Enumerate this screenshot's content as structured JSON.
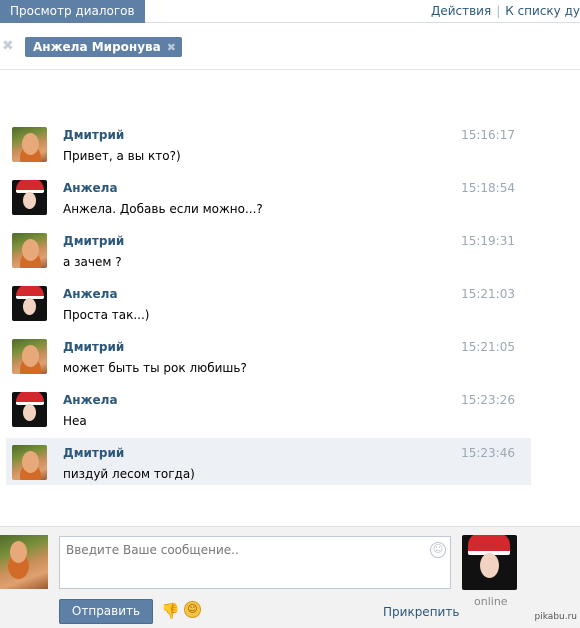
{
  "topbar": {
    "tab": "Просмотр диалогов",
    "links": [
      "Действия",
      "К списку ду"
    ]
  },
  "recipient": {
    "name": "Анжела Миронува"
  },
  "messages": [
    {
      "author": "Дмитрий",
      "text": "Привет, а вы кто?)",
      "time": "15:16:17",
      "avatar": "dmitry"
    },
    {
      "author": "Анжела",
      "text": "Анжела. Добавь если можно...?",
      "time": "15:18:54",
      "avatar": "anzhela"
    },
    {
      "author": "Дмитрий",
      "text": "а зачем ?",
      "time": "15:19:31",
      "avatar": "dmitry"
    },
    {
      "author": "Анжела",
      "text": "Проста так...)",
      "time": "15:21:03",
      "avatar": "anzhela"
    },
    {
      "author": "Дмитрий",
      "text": "может быть ты рок любишь?",
      "time": "15:21:05",
      "avatar": "dmitry"
    },
    {
      "author": "Анжела",
      "text": "Неа",
      "time": "15:23:26",
      "avatar": "anzhela"
    },
    {
      "author": "Дмитрий",
      "text": "пиздуй лесом тогда)",
      "time": "15:23:46",
      "avatar": "dmitry",
      "highlighted": true
    }
  ],
  "composer": {
    "placeholder": "Введите Ваше сообщение..",
    "send_label": "Отправить",
    "attach_label": "Прикрепить",
    "status": "online"
  },
  "watermark": "pikabu.ru",
  "colors": {
    "accent": "#5e80a6",
    "link": "#2b587a",
    "highlight_row": "#edf1f5",
    "time": "#9aa7b4"
  }
}
